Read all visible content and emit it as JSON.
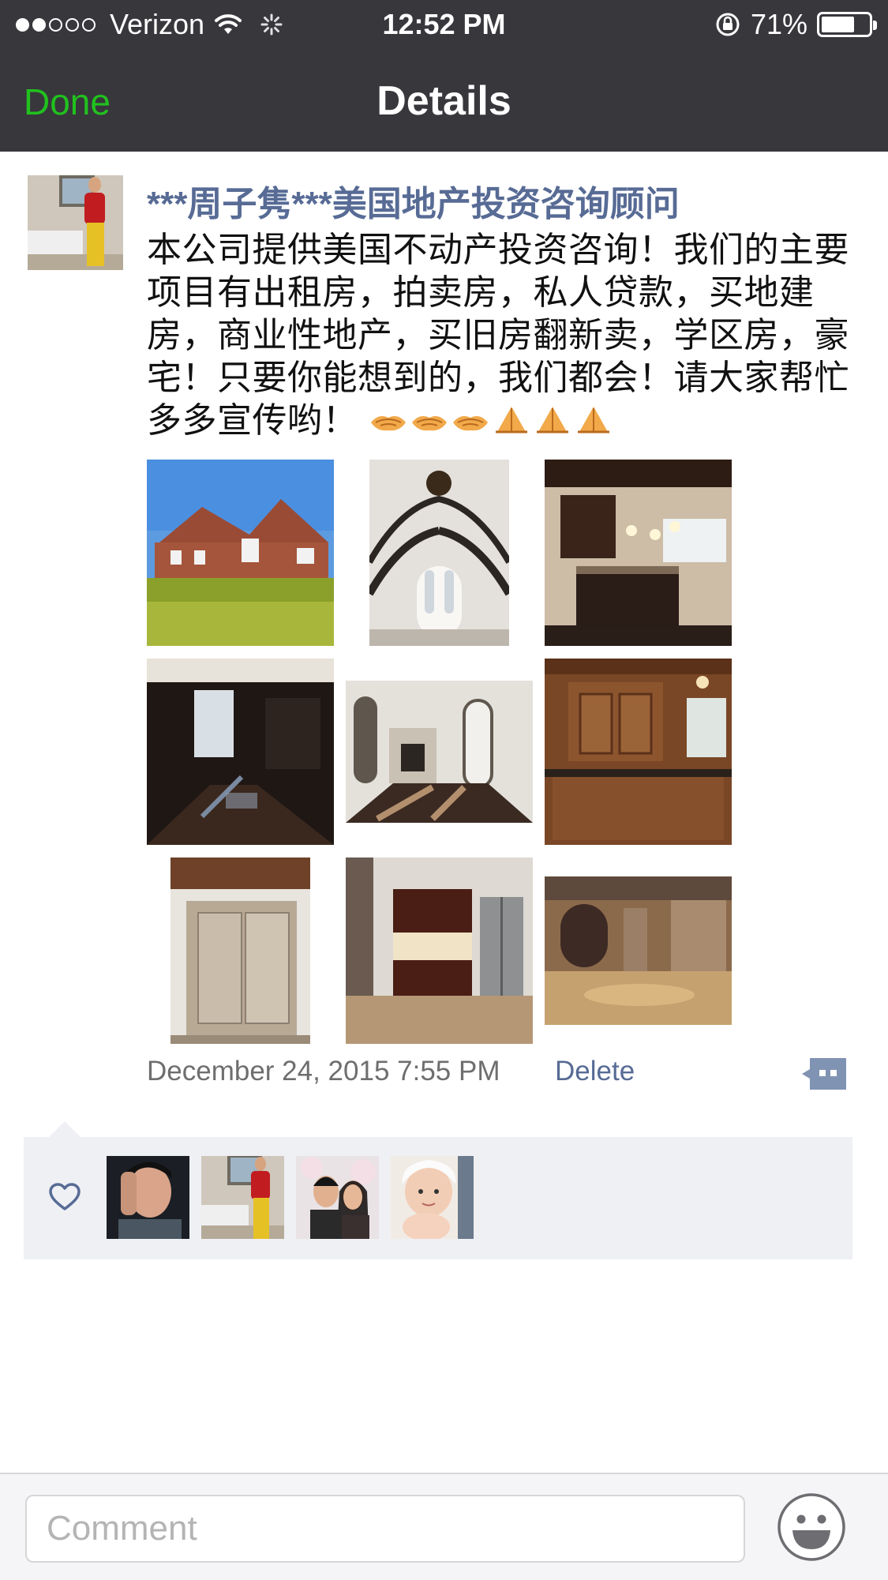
{
  "status_bar": {
    "carrier": "Verizon",
    "time": "12:52 PM",
    "battery_percent": "71%",
    "battery_level": 0.71,
    "signal_bars_filled": 2,
    "signal_bars_total": 5
  },
  "nav": {
    "done_label": "Done",
    "title": "Details"
  },
  "post": {
    "author": "***周子隽***美国地产投资咨询顾问",
    "text": "本公司提供美国不动产投资咨询！我们的主要项目有出租房，拍卖房，私人贷款，买地建房，商业性地产，买旧房翻新卖，学区房，豪宅！只要你能想到的，我们都会！请大家帮忙多多宣传哟！",
    "emojis": [
      "handshake-emoji",
      "handshake-emoji",
      "handshake-emoji",
      "pray-emoji",
      "pray-emoji",
      "pray-emoji"
    ],
    "photos": [
      "house-exterior-photo",
      "grand-staircase-photo",
      "kitchen-island-photo",
      "dark-room-photo",
      "fireplace-room-photo",
      "wood-cabinets-photo",
      "glass-shower-photo",
      "basement-kitchen-photo",
      "stone-basement-photo"
    ],
    "timestamp": "December 24, 2015 7:55 PM",
    "delete_label": "Delete"
  },
  "likes": {
    "avatars": [
      "liker-avatar-1",
      "liker-avatar-2",
      "liker-avatar-3",
      "liker-avatar-4"
    ]
  },
  "comment_bar": {
    "placeholder": "Comment"
  },
  "colors": {
    "nav_bg": "#38373c",
    "done_green": "#21c11e",
    "link_blue": "#576b95",
    "likes_bg": "#eff0f4"
  }
}
